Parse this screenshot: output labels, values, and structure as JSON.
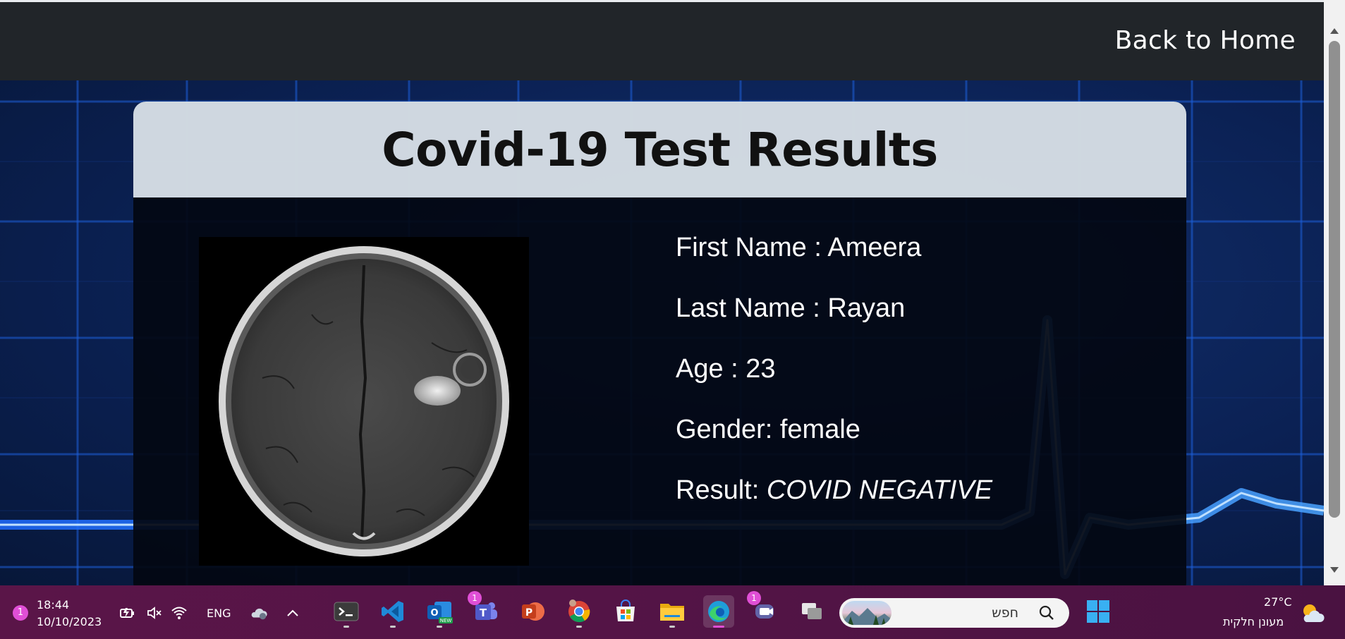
{
  "navbar": {
    "back_home_label": "Back to Home"
  },
  "card": {
    "title": "Covid-19 Test Results",
    "info": {
      "first_name": "First Name : Ameera",
      "last_name": "Last Name : Rayan",
      "age": "Age : 23",
      "gender": "Gender: female",
      "result_label": "Result: ",
      "result_value": "COVID NEGATIVE"
    }
  },
  "taskbar": {
    "notification_count": "1",
    "time": "18:44",
    "date": "10/10/2023",
    "language": "ENG",
    "search_placeholder": "חפש",
    "teams_badge": "1",
    "chat_badge": "1",
    "weather_temp": "27°C",
    "weather_desc": "מעונן חלקית",
    "apps": [
      "terminal-icon",
      "vscode-icon",
      "outlook-icon",
      "teams-icon",
      "powerpoint-icon",
      "chrome-icon",
      "store-icon",
      "file-explorer-icon",
      "edge-icon",
      "chat-icon",
      "task-view-icon",
      "start-icon"
    ]
  },
  "colors": {
    "navbar": "#212529",
    "taskbar": "#531446",
    "accent": "#e04fd6"
  }
}
